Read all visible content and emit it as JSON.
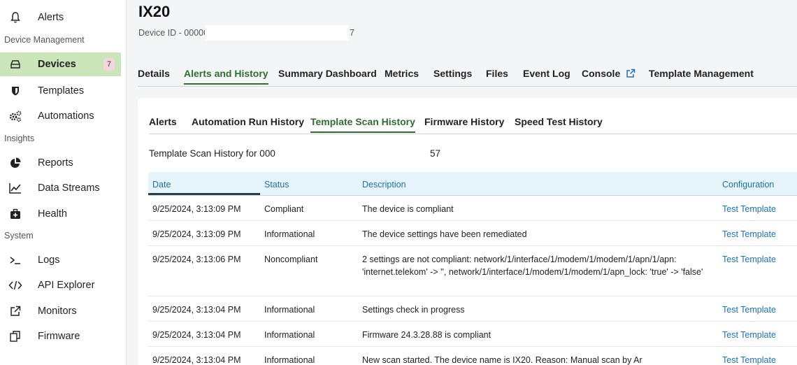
{
  "sidebar": {
    "items": [
      {
        "label": "Alerts",
        "icon": "bell-icon"
      },
      {
        "label": "Devices",
        "icon": "device-drive-icon",
        "badge": "7"
      },
      {
        "label": "Templates",
        "icon": "shield-icon"
      },
      {
        "label": "Automations",
        "icon": "gears-icon"
      },
      {
        "label": "Reports",
        "icon": "pie-chart-icon"
      },
      {
        "label": "Data Streams",
        "icon": "line-chart-icon"
      },
      {
        "label": "Health",
        "icon": "medkit-icon"
      },
      {
        "label": "Logs",
        "icon": "terminal-icon"
      },
      {
        "label": "API Explorer",
        "icon": "code-icon"
      },
      {
        "label": "Monitors",
        "icon": "external-link-icon"
      },
      {
        "label": "Firmware",
        "icon": "copy-icon"
      }
    ],
    "sections": [
      "Device Management",
      "Insights",
      "System"
    ]
  },
  "device": {
    "title": "IX20",
    "id_prefix": "Device ID - 00000",
    "id_suffix": "7"
  },
  "tabs": [
    "Details",
    "Alerts and History",
    "Summary Dashboard",
    "Metrics",
    "Settings",
    "Files",
    "Event Log",
    "Console",
    "Template Management"
  ],
  "subtabs": [
    "Alerts",
    "Automation Run History",
    "Template Scan History",
    "Firmware History",
    "Speed Test History"
  ],
  "scan_for_prefix": "Template Scan History for 000",
  "scan_for_suffix": "57",
  "table": {
    "headers": [
      "Date",
      "Status",
      "Description",
      "Configuration"
    ],
    "rows": [
      {
        "date": "9/25/2024, 3:13:09 PM",
        "status": "Compliant",
        "description": "The device is compliant",
        "config": "Test Template"
      },
      {
        "date": "9/25/2024, 3:13:09 PM",
        "status": "Informational",
        "description": "The device settings have been remediated",
        "config": "Test Template"
      },
      {
        "date": "9/25/2024, 3:13:06 PM",
        "status": "Noncompliant",
        "description": "2 settings are not compliant: network/1/interface/1/modem/1/modem/1/apn/1/apn: 'internet.telekom' -> '', network/1/interface/1/modem/1/modem/1/apn_lock: 'true' -> 'false'",
        "config": "Test Template"
      },
      {
        "date": "9/25/2024, 3:13:04 PM",
        "status": "Informational",
        "description": "Settings check in progress",
        "config": "Test Template"
      },
      {
        "date": "9/25/2024, 3:13:04 PM",
        "status": "Informational",
        "description": "Firmware 24.3.28.88 is compliant",
        "config": "Test Template"
      },
      {
        "date": "9/25/2024, 3:13:04 PM",
        "status": "Informational",
        "description": "New scan started. The device name is IX20. Reason: Manual scan by Ar",
        "config": "Test Template"
      }
    ]
  },
  "colors": {
    "accent": "#2f6e31",
    "active_bg": "#c9e5b9",
    "link": "#1f72b8",
    "header_bg": "#e6f4fb"
  }
}
